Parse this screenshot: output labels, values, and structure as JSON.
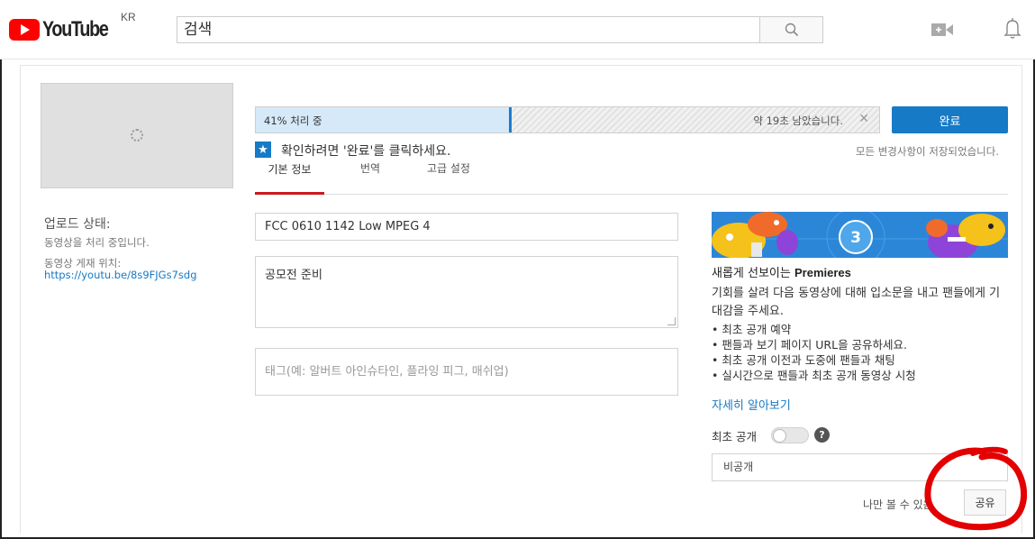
{
  "header": {
    "logo_text": "YouTube",
    "region": "KR",
    "search_placeholder": "검색",
    "icons": [
      "search-icon",
      "video-camera-icon",
      "bell-icon"
    ]
  },
  "upload": {
    "status_label": "업로드 상태:",
    "status_text": "동영상을 처리 중입니다.",
    "location_label": "동영상 게재 위치:",
    "url": "https://youtu.be/8s9FJGs7sdg"
  },
  "progress": {
    "percent": 41,
    "label": "41% 처리 중",
    "remaining": "약 19초 남았습니다.",
    "close": "✕",
    "done_label": "완료"
  },
  "notice": {
    "confirm_text": "확인하려면 '완료'를 클릭하세요.",
    "saved_text": "모든 변경사항이 저장되었습니다."
  },
  "tabs": [
    {
      "label": "기본 정보",
      "active": true
    },
    {
      "label": "번역",
      "active": false
    },
    {
      "label": "고급 설정",
      "active": false
    }
  ],
  "form": {
    "title_value": "FCC 0610 1142 Low MPEG 4",
    "description_value": "공모전 준비",
    "tags_placeholder": "태그(예: 알버트 아인슈타인, 플라잉 피그, 매쉬업)"
  },
  "premieres": {
    "badge_number": "3",
    "title_prefix": "새롭게 선보이는 ",
    "title_bold": "Premieres",
    "description": "기회를 살려 다음 동영상에 대해 입소문을 내고 팬들에게 기대감을 주세요.",
    "items": [
      "최초 공개 예약",
      "팬들과 보기 페이지 URL을 공유하세요.",
      "최초 공개 이전과 도중에 팬들과 채팅",
      "실시간으로 팬들과 최초 공개 동영상 시청"
    ],
    "learn_more": "자세히 알아보기",
    "toggle_label": "최초 공개",
    "help_glyph": "?"
  },
  "privacy": {
    "selected": "비공개",
    "hint": "나만 볼 수 있음",
    "share_label": "공유"
  },
  "colors": {
    "brand_red": "#ff0000",
    "accent_blue": "#167ac6",
    "tab_active_red": "#cc181e",
    "annotation_red": "#e30000"
  }
}
